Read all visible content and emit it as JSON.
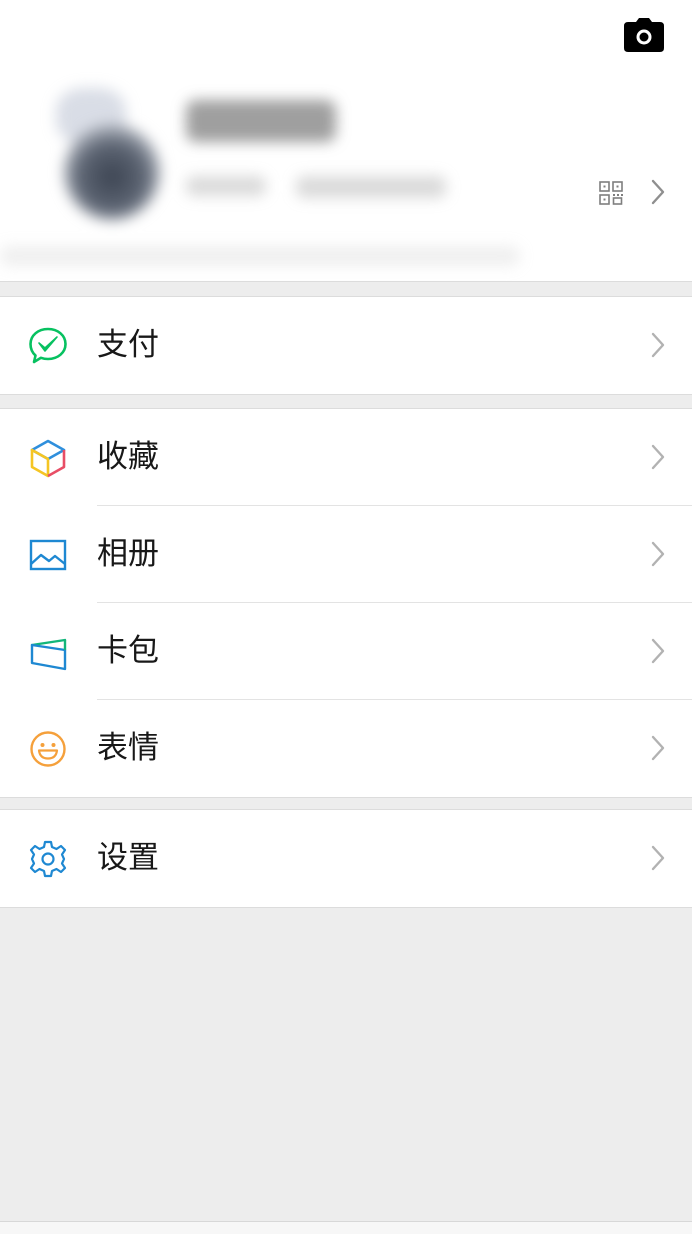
{
  "profile": {
    "camera_icon": "camera-icon",
    "qr_icon": "qr-code-icon",
    "chevron_icon": "chevron-right-icon"
  },
  "menu": {
    "pay": {
      "label": "支付",
      "icon": "wechat-pay-icon",
      "color": "#07c160"
    },
    "favorites": {
      "label": "收藏",
      "icon": "favorites-cube-icon"
    },
    "album": {
      "label": "相册",
      "icon": "album-photo-icon",
      "color": "#1e88d2"
    },
    "cards": {
      "label": "卡包",
      "icon": "card-wallet-icon"
    },
    "stickers": {
      "label": "表情",
      "icon": "smiley-icon",
      "color": "#f5a03b"
    },
    "settings": {
      "label": "设置",
      "icon": "gear-icon",
      "color": "#1e88d2"
    }
  },
  "colors": {
    "background": "#ededed",
    "surface": "#ffffff",
    "chevron": "#b2b2b2"
  }
}
